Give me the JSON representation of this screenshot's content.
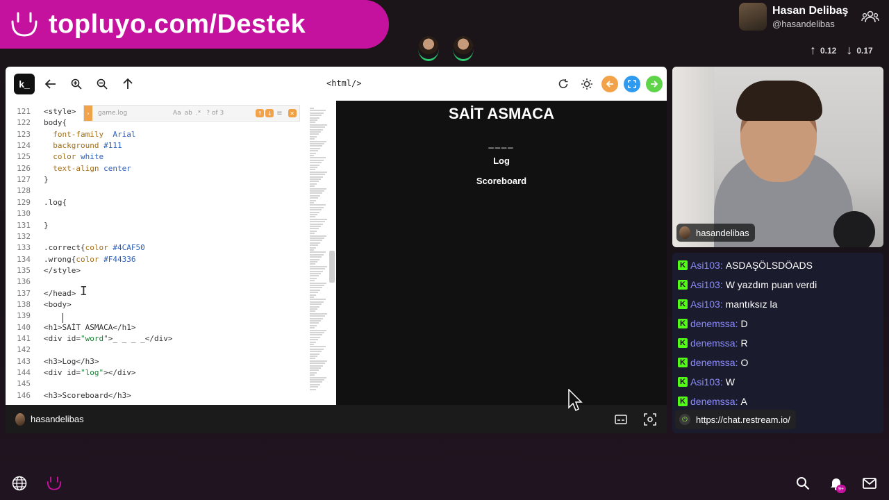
{
  "banner": {
    "text": "topluyo.com/Destek"
  },
  "profile": {
    "name": "Hasan Delibaş",
    "handle": "@hasandelibas"
  },
  "stats": {
    "upload": "0.12",
    "download": "0.17"
  },
  "browser": {
    "logo": "k_",
    "title": "<html/>"
  },
  "findbar": {
    "query": "game.log",
    "case_opt": "Aa",
    "word_opt": "ab",
    "regex_opt": ".*",
    "count": "? of 3"
  },
  "code": {
    "lines": [
      {
        "no": "121",
        "text": "<style>"
      },
      {
        "no": "122",
        "text": "body{"
      },
      {
        "no": "123",
        "text": "  font-family: Arial;"
      },
      {
        "no": "124",
        "text": "  background:#111;"
      },
      {
        "no": "125",
        "text": "  color:white;"
      },
      {
        "no": "126",
        "text": "  text-align:center;"
      },
      {
        "no": "127",
        "text": "}"
      },
      {
        "no": "128",
        "text": ""
      },
      {
        "no": "129",
        "text": ".log{"
      },
      {
        "no": "130",
        "text": ""
      },
      {
        "no": "131",
        "text": "}"
      },
      {
        "no": "132",
        "text": ""
      },
      {
        "no": "133",
        "text": ".correct{color:#4CAF50}"
      },
      {
        "no": "134",
        "text": ".wrong{color:#F44336}"
      },
      {
        "no": "135",
        "text": "</style>"
      },
      {
        "no": "136",
        "text": ""
      },
      {
        "no": "137",
        "text": "</head>"
      },
      {
        "no": "138",
        "text": "<body>"
      },
      {
        "no": "139",
        "text": ""
      },
      {
        "no": "140",
        "text": "<h1>SAİT ASMACA</h1>"
      },
      {
        "no": "141",
        "text": "<div id=\"word\">_ _ _ _</div>"
      },
      {
        "no": "142",
        "text": ""
      },
      {
        "no": "143",
        "text": "<h3>Log</h3>"
      },
      {
        "no": "144",
        "text": "<div id=\"log\"></div>"
      },
      {
        "no": "145",
        "text": ""
      },
      {
        "no": "146",
        "text": "<h3>Scoreboard</h3>"
      }
    ]
  },
  "preview": {
    "title": "SAİT ASMACA",
    "word": "____",
    "log_heading": "Log",
    "scoreboard_heading": "Scoreboard"
  },
  "browser_footer": {
    "name": "hasandelibas"
  },
  "webcam": {
    "label": "hasandelibas"
  },
  "chat": {
    "messages": [
      {
        "user": "Asi103",
        "text": "ASDAŞÖLSDÖADS"
      },
      {
        "user": "Asi103",
        "text": "W yazdım puan verdi"
      },
      {
        "user": "Asi103",
        "text": "mantıksız la"
      },
      {
        "user": "denemssa",
        "text": "D"
      },
      {
        "user": "denemssa",
        "text": "R"
      },
      {
        "user": "denemssa",
        "text": "O"
      },
      {
        "user": "Asi103",
        "text": "W"
      },
      {
        "user": "denemssa",
        "text": "A"
      }
    ],
    "footer_url": "https://chat.restream.io/"
  },
  "notifications": {
    "badge": "9+"
  },
  "colors": {
    "brand": "#c4129f",
    "kick_green": "#53fc18",
    "chat_user": "#8b8dfb",
    "toolbar_orange": "#f2a34a",
    "toolbar_blue": "#2f9bf0",
    "toolbar_green": "#5fd34a"
  }
}
